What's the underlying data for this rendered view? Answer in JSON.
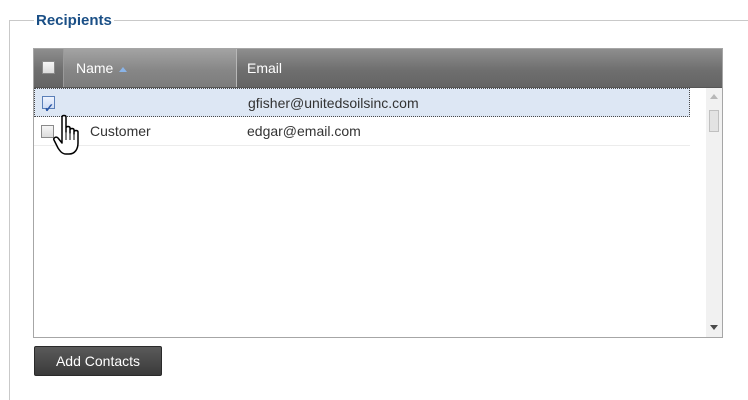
{
  "recipients": {
    "legend": "Recipients",
    "columns": {
      "name": "Name",
      "email": "Email"
    },
    "sort": {
      "column": "name",
      "direction": "ascending"
    },
    "rows": [
      {
        "checked": true,
        "name": "",
        "email": "gfisher@unitedsoilsinc.com",
        "selected": true
      },
      {
        "checked": false,
        "name": "Customer",
        "email": "edgar@email.com",
        "selected": false
      }
    ]
  },
  "add_contacts_label": "Add Contacts",
  "icons": {
    "sort": "sort-ascending-icon",
    "cursor": "hand-pointer-icon"
  },
  "colors": {
    "legend": "#1a4f86",
    "header": "#7a7a7a",
    "selected_row": "#dde7f4",
    "button": "#444444"
  }
}
